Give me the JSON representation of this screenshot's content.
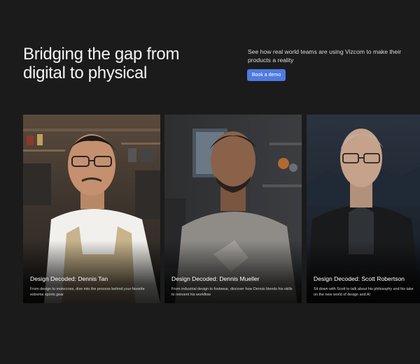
{
  "hero": {
    "title_line1": "Bridging the gap from",
    "title_line2": "digital to physical",
    "description": "See how real world teams are using Vizcom to make their products a reality",
    "cta_label": "Book a demo"
  },
  "colors": {
    "background": "#1b1b1c",
    "accent": "#4f7be0"
  },
  "cards": [
    {
      "title": "Design Decoded: Dennis Tan",
      "description": "From design to motocross, dive into the process behind your favorite extreme sports gear"
    },
    {
      "title": "Design Decoded: Dennis Mueller",
      "description": "From industrial design to footwear, discover how Dennis blends his skills to reinvent his workflow"
    },
    {
      "title": "Design Decoded: Scott Robertson",
      "description": "Sit down with Scott to talk about his philosophy and his take on the new world of design and AI"
    }
  ]
}
